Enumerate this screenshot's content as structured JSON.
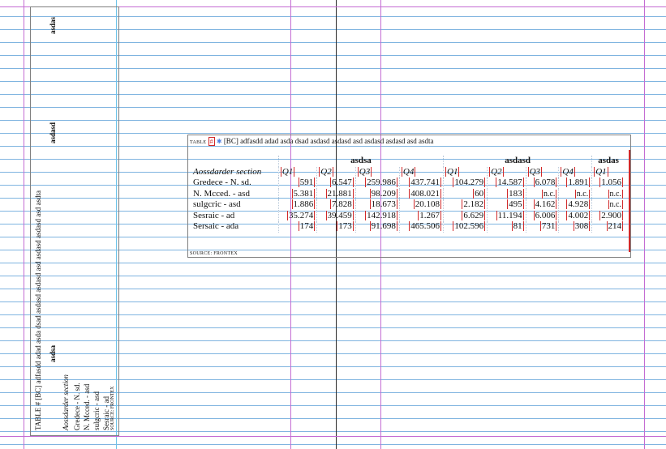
{
  "colors": {
    "baseline": "#7fb4e0",
    "margin_guide": "#c46cd3",
    "column_guide": "#2b2b2b",
    "overflow_marker": "#d12a2a",
    "marker_blue": "#4f7fe0"
  },
  "table": {
    "label": "TABLE",
    "number": "#",
    "code": "[BC]",
    "caption": "adfasdd adad asda dsad asdasd asdasd asd asdasd asdasd asd asdta",
    "groups": [
      "asdsa",
      "asdasd",
      "asdas"
    ],
    "row_header": "Aossdarder section",
    "quarters": [
      "Q1",
      "Q2",
      "Q3",
      "Q4",
      "Q1",
      "Q2",
      "Q3",
      "Q4",
      "Q1"
    ],
    "rows": [
      {
        "label": "Gredece - N. sd.",
        "values": [
          "591",
          "6.547",
          "259.986",
          "437.741",
          "104.279",
          "14.587",
          "6.078",
          "1.891",
          "1.056"
        ]
      },
      {
        "label": "N. Mcced. - asd",
        "values": [
          "5.381",
          "21.881",
          "98.209",
          "408.021",
          "60",
          "183",
          "n.c.",
          "n.c.",
          "n.c."
        ]
      },
      {
        "label": "sulgcric - asd",
        "values": [
          "1.886",
          "7.828",
          "18.673",
          "20.108",
          "2.182",
          "495",
          "4.162",
          "4.928",
          "n.c."
        ]
      },
      {
        "label": "Sesraic - ad",
        "values": [
          "35.274",
          "39.459",
          "142.918",
          "1.267",
          "6.629",
          "11.194",
          "6.006",
          "4.002",
          "2.900"
        ]
      },
      {
        "label": "Sersaic - ada",
        "values": [
          "174",
          "173",
          "91.698",
          "465.506",
          "102.596",
          "81",
          "731",
          "308",
          "214"
        ]
      }
    ],
    "source": "SOURCE: FRONTEX"
  },
  "rotated": {
    "caption": "TABLE # [BC] adfasdd adad asda dsad asdasd asdasd asd asdasd asdasd asd asdta",
    "groups": [
      "asdsa",
      "asdasd",
      "asdas"
    ],
    "source": "SOURCE: FRONTEX"
  }
}
